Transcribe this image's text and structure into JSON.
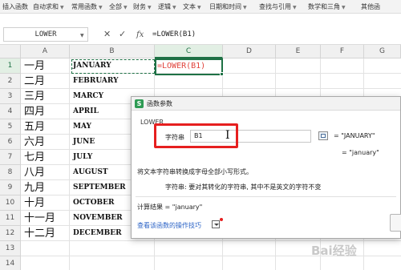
{
  "ribbon": {
    "tabs": [
      {
        "label": "插入函数",
        "dropdown": false
      },
      {
        "label": "自动求和",
        "dropdown": true
      },
      {
        "label": "常用函数",
        "dropdown": true
      },
      {
        "label": "全部",
        "dropdown": true
      },
      {
        "label": "财务",
        "dropdown": true
      },
      {
        "label": "逻辑",
        "dropdown": true
      },
      {
        "label": "文本",
        "dropdown": true
      },
      {
        "label": "日期和时间",
        "dropdown": true
      },
      {
        "label": "查找与引用",
        "dropdown": true
      },
      {
        "label": "数学和三角",
        "dropdown": true
      },
      {
        "label": "其他函",
        "dropdown": false
      }
    ]
  },
  "formula_bar": {
    "name_box": "LOWER",
    "fx_label": "fx",
    "formula": "=LOWER(B1)"
  },
  "sheet": {
    "columns": [
      "A",
      "B",
      "C",
      "D",
      "E",
      "F",
      "G"
    ],
    "rows": [
      "1",
      "2",
      "3",
      "4",
      "5",
      "6",
      "7",
      "8",
      "9",
      "10",
      "11",
      "12",
      "13",
      "14"
    ],
    "col_a": [
      "一月",
      "二月",
      "三月",
      "四月",
      "五月",
      "六月",
      "七月",
      "八月",
      "九月",
      "十月",
      "十一月",
      "十二月"
    ],
    "col_b": [
      "JANUARY",
      "FEBRUARY",
      "MARCY",
      "APRIL",
      "MAY",
      "JUNE",
      "JULY",
      "AUGUST",
      "SEPTEMBER",
      "OCTOBER",
      "NOVEMBER",
      "DECEMBER"
    ],
    "c1": "=LOWER(B1)"
  },
  "dialog": {
    "title": "函数参数",
    "icon_letter": "S",
    "function_name": "LOWER",
    "arg_label": "字符串",
    "arg_value": "B1",
    "arg_result": "= \"JANUARY\"",
    "result": "= \"january\"",
    "description": "将文本字符串转换成字母全部小写形式。",
    "arg_description": "字符串:  要对其转化的字符串, 其中不是英文的字符不变",
    "calc_result": "计算结果 =  \"january\"",
    "help_link": "查看该函数的操作技巧"
  },
  "colors": {
    "accent_green": "#1e7145",
    "highlight_red": "#e61f1f",
    "link_blue": "#2b63c6"
  },
  "watermark": "Bai经验"
}
